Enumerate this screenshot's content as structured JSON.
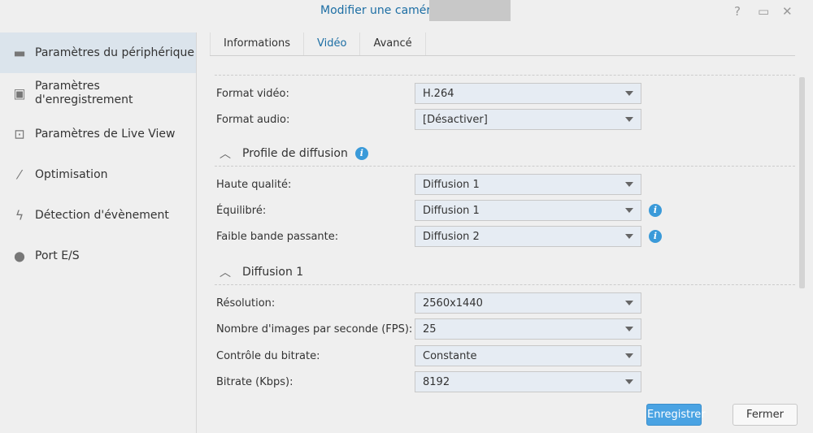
{
  "window": {
    "title": "Modifier une caméra",
    "help": "?",
    "maximize": "▭",
    "close": "✕"
  },
  "sidebar": {
    "items": [
      {
        "label": "Paramètres du périphérique",
        "icon": "camera-icon",
        "active": true
      },
      {
        "label": "Paramètres d'enregistrement",
        "icon": "calendar-icon"
      },
      {
        "label": "Paramètres de Live View",
        "icon": "live-view-icon"
      },
      {
        "label": "Optimisation",
        "icon": "magic-wand-icon"
      },
      {
        "label": "Détection d'évènement",
        "icon": "lightning-icon"
      },
      {
        "label": "Port E/S",
        "icon": "bulb-icon"
      }
    ]
  },
  "tabs": [
    {
      "label": "Informations"
    },
    {
      "label": "Vidéo",
      "active": true
    },
    {
      "label": "Avancé"
    }
  ],
  "form": {
    "video_format": {
      "label": "Format vidéo:",
      "value": "H.264"
    },
    "audio_format": {
      "label": "Format audio:",
      "value": "[Désactiver]"
    },
    "profile_section": "Profile de diffusion",
    "high_quality": {
      "label": "Haute qualité:",
      "value": "Diffusion 1"
    },
    "balanced": {
      "label": "Équilibré:",
      "value": "Diffusion 1"
    },
    "low_bandwidth": {
      "label": "Faible bande passante:",
      "value": "Diffusion 2"
    },
    "stream1_section": "Diffusion 1",
    "resolution": {
      "label": "Résolution:",
      "value": "2560x1440"
    },
    "fps": {
      "label": "Nombre d'images par seconde (FPS):",
      "value": "25"
    },
    "bitrate_control": {
      "label": "Contrôle du bitrate:",
      "value": "Constante"
    },
    "bitrate": {
      "label": "Bitrate (Kbps):",
      "value": "8192"
    }
  },
  "footer": {
    "save": "Enregistrer",
    "close": "Fermer"
  },
  "colors": {
    "accent": "#4aa3e3",
    "title": "#1c6ea4",
    "active_item": "#dbe4ec"
  }
}
